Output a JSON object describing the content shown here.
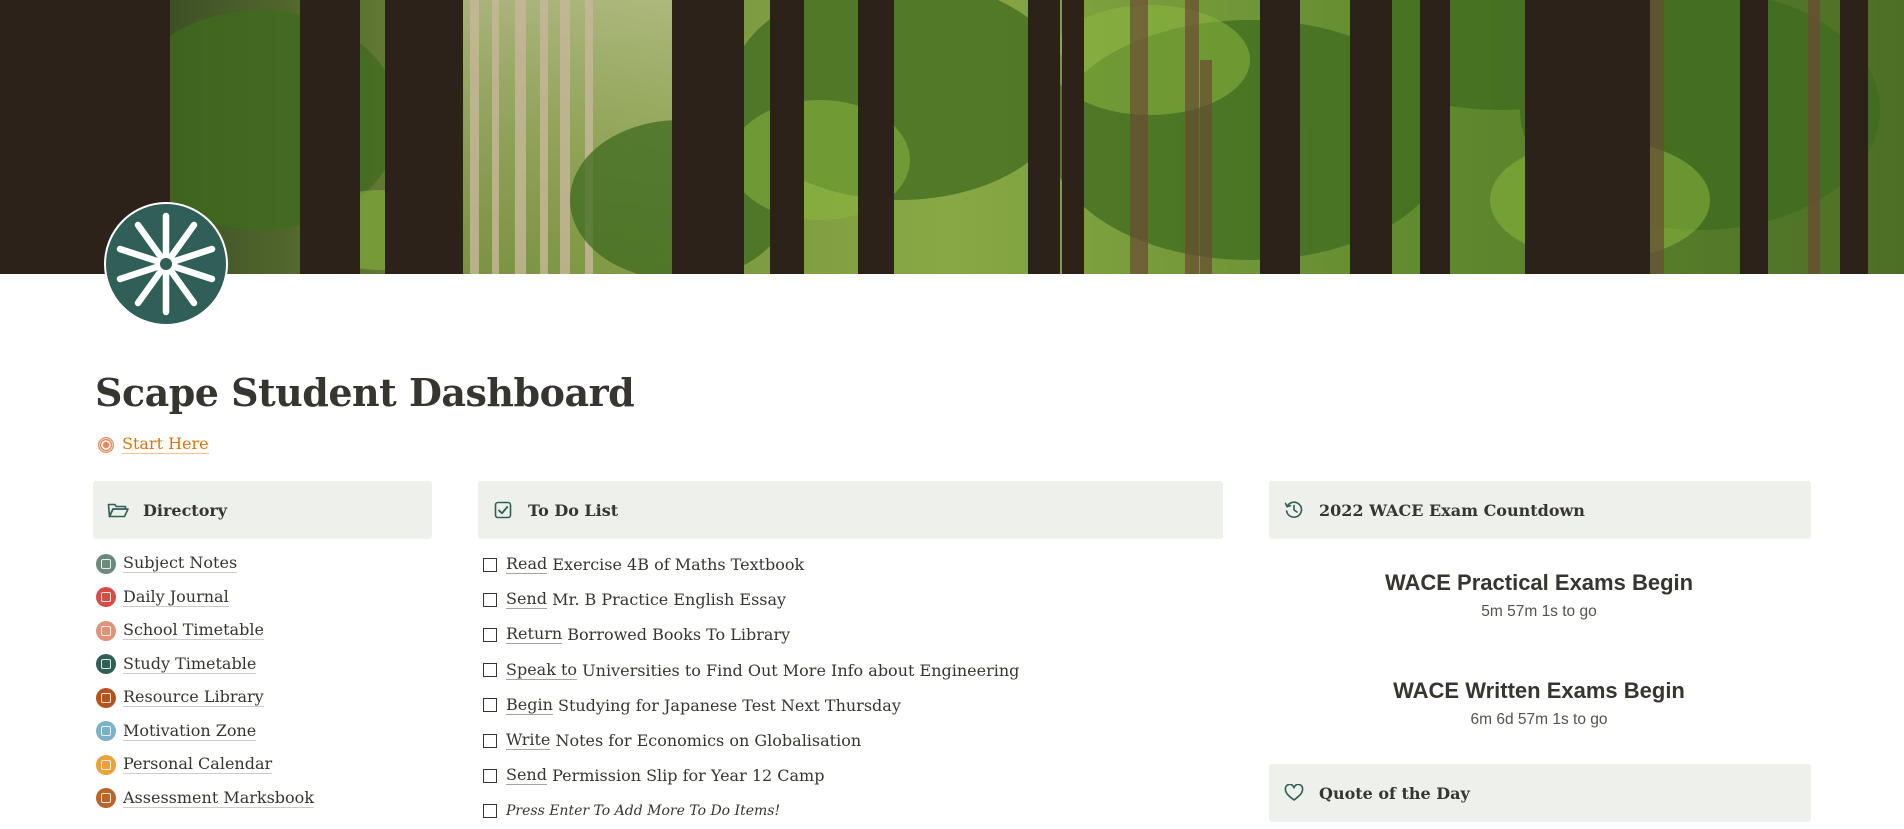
{
  "page": {
    "title": "Scape Student Dashboard",
    "icon": "asterisk-starburst-icon",
    "cover": "forest-trees-image",
    "start_here": {
      "label": "Start Here",
      "icon": "lifebuoy-icon",
      "color": "#d9730d"
    }
  },
  "colors": {
    "header_bg": "#edf0eb",
    "icon_bg": "#2f5f57",
    "text": "#37352f"
  },
  "directory": {
    "title": "Directory",
    "icon": "folder-open-icon",
    "items": [
      {
        "label": "Subject Notes",
        "icon": "pencil-icon",
        "color": "#6c8a7c"
      },
      {
        "label": "Daily Journal",
        "icon": "notebook-icon",
        "color": "#d44c47"
      },
      {
        "label": "School Timetable",
        "icon": "grid-icon",
        "color": "#e0927a"
      },
      {
        "label": "Study Timetable",
        "icon": "table-icon",
        "color": "#2f5f57"
      },
      {
        "label": "Resource Library",
        "icon": "books-icon",
        "color": "#b3541e"
      },
      {
        "label": "Motivation Zone",
        "icon": "lightbulb-icon",
        "color": "#7ab3c9"
      },
      {
        "label": "Personal Calendar",
        "icon": "calendar-icon",
        "color": "#e9a13b"
      },
      {
        "label": "Assessment Marksbook",
        "icon": "clipboard-icon",
        "color": "#b8642a"
      }
    ]
  },
  "todo": {
    "title": "To Do List",
    "icon": "checkbox-icon",
    "items": [
      {
        "verb": "Read",
        "rest": " Exercise 4B of Maths Textbook",
        "checked": false
      },
      {
        "verb": "Send",
        "rest": " Mr. B Practice English Essay",
        "checked": false
      },
      {
        "verb": "Return",
        "rest": " Borrowed Books To Library",
        "checked": false
      },
      {
        "verb": "Speak to",
        "rest": " Universities to Find Out More Info about Engineering",
        "checked": false
      },
      {
        "verb": "Begin",
        "rest": " Studying for Japanese Test Next Thursday",
        "checked": false
      },
      {
        "verb": "Write",
        "rest": " Notes for Economics on Globalisation",
        "checked": false
      },
      {
        "verb": "Send",
        "rest": " Permission Slip for Year 12 Camp",
        "checked": false
      }
    ],
    "add_hint": "Press Enter To Add More To Do Items!"
  },
  "countdown": {
    "title": "2022 WACE Exam Countdown",
    "icon": "history-clock-icon",
    "events": [
      {
        "title": "WACE Practical Exams Begin",
        "remaining": "5m 57m 1s to go"
      },
      {
        "title": "WACE Written Exams Begin",
        "remaining": "6m 6d 57m 1s to go"
      }
    ]
  },
  "quote": {
    "title": "Quote of the Day",
    "icon": "heart-icon"
  }
}
